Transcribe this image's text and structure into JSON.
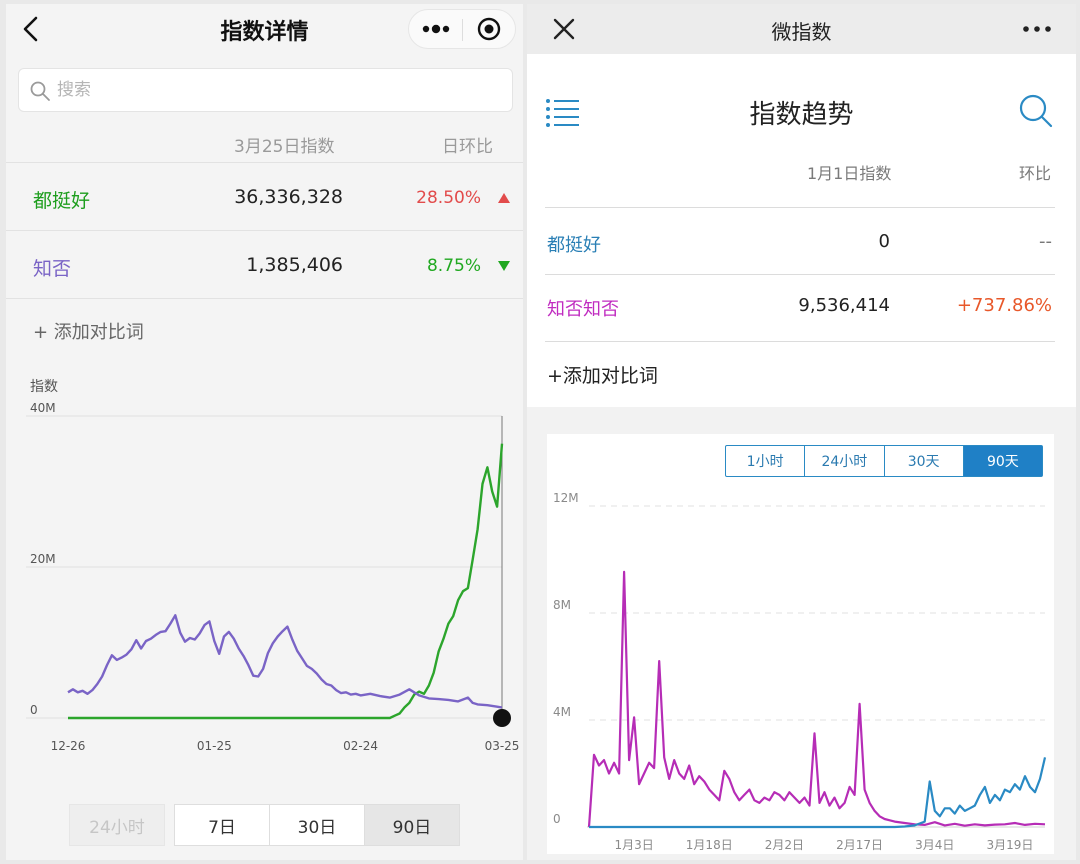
{
  "left": {
    "title": "指数详情",
    "search_placeholder": "搜索",
    "header_index": "3月25日指数",
    "header_change": "日环比",
    "rows": [
      {
        "name": "都挺好",
        "value": "36,336,328",
        "change": "28.50%",
        "direction": "up",
        "name_color": "#1e9e1e",
        "change_color": "#e24b4b"
      },
      {
        "name": "知否",
        "value": "1,385,406",
        "change": "8.75%",
        "direction": "down",
        "name_color": "#7a64c6",
        "change_color": "#20a820"
      }
    ],
    "add_compare": "+ 添加对比词",
    "range_buttons": [
      {
        "label": "24小时",
        "state": "disabled"
      },
      {
        "label": "7日",
        "state": "normal"
      },
      {
        "label": "30日",
        "state": "normal"
      },
      {
        "label": "90日",
        "state": "active"
      }
    ],
    "chart_data": {
      "type": "line",
      "ylabel": "指数",
      "ylim": [
        0,
        40000000
      ],
      "y_ticks": [
        {
          "value": 0,
          "label": "0"
        },
        {
          "value": 20000000,
          "label": "20M"
        },
        {
          "value": 40000000,
          "label": "40M"
        }
      ],
      "x_ticks": [
        {
          "x": 0,
          "label": "12-26"
        },
        {
          "x": 30,
          "label": "01-25"
        },
        {
          "x": 60,
          "label": "02-24"
        },
        {
          "x": 89,
          "label": "03-25"
        }
      ],
      "xlim": [
        0,
        89
      ],
      "series": [
        {
          "name": "都挺好",
          "color": "#2ca52c",
          "points": [
            [
              0,
              0
            ],
            [
              20,
              0
            ],
            [
              40,
              0
            ],
            [
              66,
              0
            ],
            [
              67,
              300000
            ],
            [
              68,
              600000
            ],
            [
              69,
              1400000
            ],
            [
              70,
              2000000
            ],
            [
              71,
              3100000
            ],
            [
              72,
              3500000
            ],
            [
              73,
              3200000
            ],
            [
              74,
              4300000
            ],
            [
              75,
              6000000
            ],
            [
              76,
              8800000
            ],
            [
              77,
              10500000
            ],
            [
              78,
              12500000
            ],
            [
              79,
              13500000
            ],
            [
              80,
              15600000
            ],
            [
              81,
              16800000
            ],
            [
              82,
              17200000
            ],
            [
              83,
              21000000
            ],
            [
              84,
              25000000
            ],
            [
              85,
              31000000
            ],
            [
              86,
              33200000
            ],
            [
              87,
              30000000
            ],
            [
              88,
              28000000
            ],
            [
              89,
              36336328
            ]
          ]
        },
        {
          "name": "知否",
          "color": "#7a64c6",
          "points": [
            [
              0,
              3400000
            ],
            [
              1,
              3800000
            ],
            [
              2,
              3400000
            ],
            [
              3,
              3600000
            ],
            [
              4,
              3200000
            ],
            [
              5,
              3700000
            ],
            [
              6,
              4500000
            ],
            [
              7,
              5500000
            ],
            [
              8,
              7000000
            ],
            [
              9,
              8300000
            ],
            [
              10,
              7700000
            ],
            [
              11,
              8000000
            ],
            [
              12,
              8400000
            ],
            [
              13,
              9100000
            ],
            [
              14,
              10300000
            ],
            [
              15,
              9200000
            ],
            [
              16,
              10200000
            ],
            [
              17,
              10500000
            ],
            [
              18,
              11000000
            ],
            [
              19,
              11400000
            ],
            [
              20,
              11500000
            ],
            [
              21,
              12500000
            ],
            [
              22,
              13600000
            ],
            [
              23,
              11300000
            ],
            [
              24,
              10100000
            ],
            [
              25,
              10600000
            ],
            [
              26,
              10400000
            ],
            [
              27,
              11200000
            ],
            [
              28,
              12300000
            ],
            [
              29,
              12800000
            ],
            [
              30,
              10200000
            ],
            [
              31,
              8500000
            ],
            [
              32,
              10800000
            ],
            [
              33,
              11400000
            ],
            [
              34,
              10500000
            ],
            [
              35,
              9200000
            ],
            [
              36,
              8200000
            ],
            [
              37,
              7000000
            ],
            [
              38,
              5600000
            ],
            [
              39,
              5500000
            ],
            [
              40,
              6500000
            ],
            [
              41,
              8600000
            ],
            [
              42,
              9900000
            ],
            [
              43,
              10800000
            ],
            [
              44,
              11500000
            ],
            [
              45,
              12100000
            ],
            [
              46,
              10400000
            ],
            [
              47,
              8900000
            ],
            [
              48,
              7900000
            ],
            [
              49,
              6900000
            ],
            [
              50,
              6500000
            ],
            [
              51,
              5900000
            ],
            [
              52,
              5100000
            ],
            [
              53,
              4500000
            ],
            [
              54,
              4300000
            ],
            [
              55,
              3700000
            ],
            [
              56,
              3300000
            ],
            [
              57,
              3400000
            ],
            [
              58,
              3100000
            ],
            [
              59,
              3200000
            ],
            [
              60,
              3000000
            ],
            [
              62,
              3200000
            ],
            [
              64,
              2900000
            ],
            [
              66,
              2700000
            ],
            [
              68,
              3100000
            ],
            [
              70,
              3800000
            ],
            [
              72,
              3000000
            ],
            [
              74,
              2600000
            ],
            [
              76,
              2500000
            ],
            [
              78,
              2400000
            ],
            [
              80,
              2200000
            ],
            [
              82,
              2700000
            ],
            [
              83,
              2000000
            ],
            [
              84,
              1800000
            ],
            [
              86,
              1700000
            ],
            [
              88,
              1500000
            ],
            [
              89,
              1385406
            ]
          ]
        }
      ]
    }
  },
  "right": {
    "title": "微指数",
    "heading": "指数趋势",
    "header_index": "1月1日指数",
    "header_change": "环比",
    "rows": [
      {
        "name": "都挺好",
        "value": "0",
        "change": "--",
        "name_color": "#2a7fb5",
        "change_color": "#777777"
      },
      {
        "name": "知否知否",
        "value": "9,536,414",
        "change": "+737.86%",
        "name_color": "#c02cc0",
        "change_color": "#e8582a"
      }
    ],
    "add_compare": "+添加对比词",
    "range_buttons": [
      {
        "label": "1小时",
        "active": false
      },
      {
        "label": "24小时",
        "active": false
      },
      {
        "label": "30天",
        "active": false
      },
      {
        "label": "90天",
        "active": true
      }
    ],
    "chart_data": {
      "type": "line",
      "ylim": [
        0,
        12000000
      ],
      "y_ticks": [
        {
          "value": 0,
          "label": "0"
        },
        {
          "value": 4000000,
          "label": "4M"
        },
        {
          "value": 8000000,
          "label": "8M"
        },
        {
          "value": 12000000,
          "label": "12M"
        }
      ],
      "x_ticks": [
        {
          "x": 2,
          "label": "1月3日"
        },
        {
          "x": 17,
          "label": "1月18日"
        },
        {
          "x": 32,
          "label": "2月2日"
        },
        {
          "x": 47,
          "label": "2月17日"
        },
        {
          "x": 62,
          "label": "3月4日"
        },
        {
          "x": 77,
          "label": "3月19日"
        }
      ],
      "xlim": [
        -7,
        84
      ],
      "series": [
        {
          "name": "知否知否",
          "color": "#b62db6",
          "points": [
            [
              -7,
              0
            ],
            [
              -6,
              2700000
            ],
            [
              -5,
              2300000
            ],
            [
              -4,
              2500000
            ],
            [
              -3,
              2000000
            ],
            [
              -2,
              2400000
            ],
            [
              -1,
              2000000
            ],
            [
              0,
              9536414
            ],
            [
              1,
              2500000
            ],
            [
              2,
              4100000
            ],
            [
              3,
              1600000
            ],
            [
              4,
              2000000
            ],
            [
              5,
              2400000
            ],
            [
              6,
              2200000
            ],
            [
              7,
              6200000
            ],
            [
              8,
              2600000
            ],
            [
              9,
              1800000
            ],
            [
              10,
              2500000
            ],
            [
              11,
              2000000
            ],
            [
              12,
              1800000
            ],
            [
              13,
              2300000
            ],
            [
              14,
              1600000
            ],
            [
              15,
              1900000
            ],
            [
              16,
              1700000
            ],
            [
              17,
              1400000
            ],
            [
              18,
              1200000
            ],
            [
              19,
              1000000
            ],
            [
              20,
              2100000
            ],
            [
              21,
              1800000
            ],
            [
              22,
              1300000
            ],
            [
              23,
              1000000
            ],
            [
              24,
              1200000
            ],
            [
              25,
              1400000
            ],
            [
              26,
              1000000
            ],
            [
              27,
              900000
            ],
            [
              28,
              1100000
            ],
            [
              29,
              1000000
            ],
            [
              30,
              1300000
            ],
            [
              31,
              1200000
            ],
            [
              32,
              1000000
            ],
            [
              33,
              1300000
            ],
            [
              34,
              1100000
            ],
            [
              35,
              900000
            ],
            [
              36,
              1100000
            ],
            [
              37,
              800000
            ],
            [
              38,
              3500000
            ],
            [
              39,
              900000
            ],
            [
              40,
              1300000
            ],
            [
              41,
              800000
            ],
            [
              42,
              1100000
            ],
            [
              43,
              700000
            ],
            [
              44,
              900000
            ],
            [
              45,
              1500000
            ],
            [
              46,
              1200000
            ],
            [
              47,
              4600000
            ],
            [
              48,
              1400000
            ],
            [
              49,
              900000
            ],
            [
              50,
              600000
            ],
            [
              51,
              400000
            ],
            [
              52,
              300000
            ],
            [
              54,
              200000
            ],
            [
              56,
              150000
            ],
            [
              58,
              100000
            ],
            [
              60,
              80000
            ],
            [
              62,
              180000
            ],
            [
              64,
              60000
            ],
            [
              66,
              120000
            ],
            [
              68,
              50000
            ],
            [
              70,
              100000
            ],
            [
              72,
              60000
            ],
            [
              74,
              90000
            ],
            [
              76,
              100000
            ],
            [
              78,
              150000
            ],
            [
              80,
              80000
            ],
            [
              82,
              120000
            ],
            [
              84,
              100000
            ]
          ]
        },
        {
          "name": "都挺好",
          "color": "#2a8ac4",
          "points": [
            [
              -7,
              0
            ],
            [
              54,
              0
            ],
            [
              56,
              20000
            ],
            [
              58,
              60000
            ],
            [
              60,
              200000
            ],
            [
              61,
              1700000
            ],
            [
              62,
              600000
            ],
            [
              63,
              400000
            ],
            [
              64,
              700000
            ],
            [
              65,
              700000
            ],
            [
              66,
              500000
            ],
            [
              67,
              800000
            ],
            [
              68,
              600000
            ],
            [
              69,
              700000
            ],
            [
              70,
              800000
            ],
            [
              71,
              1200000
            ],
            [
              72,
              1500000
            ],
            [
              73,
              900000
            ],
            [
              74,
              1200000
            ],
            [
              75,
              1000000
            ],
            [
              76,
              1400000
            ],
            [
              77,
              1300000
            ],
            [
              78,
              1600000
            ],
            [
              79,
              1400000
            ],
            [
              80,
              1900000
            ],
            [
              81,
              1500000
            ],
            [
              82,
              1300000
            ],
            [
              83,
              1800000
            ],
            [
              84,
              2600000
            ]
          ]
        }
      ]
    }
  }
}
